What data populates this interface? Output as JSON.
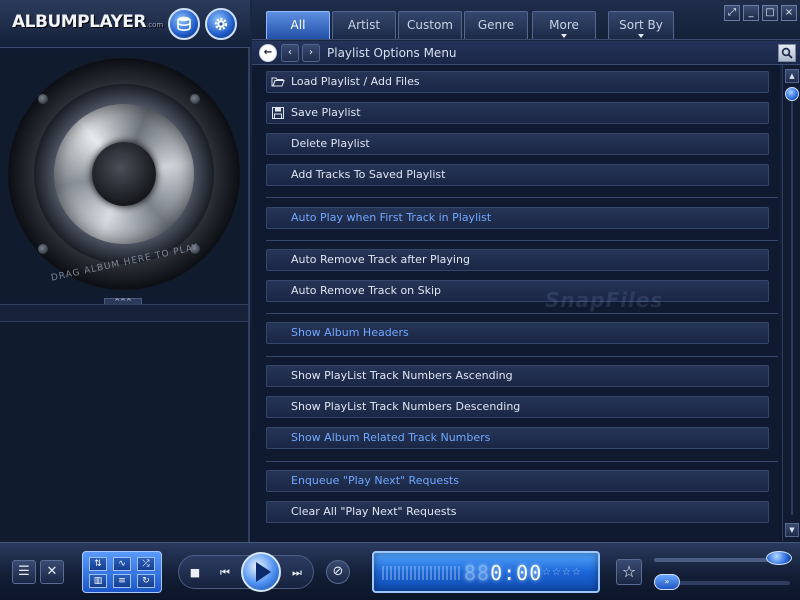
{
  "app": {
    "logo_main": "ALBUMPLAYER",
    "logo_suffix": ".com",
    "drag_hint": "DRAG ALBUM HERE TO PLAY",
    "collapse_label": "^^^"
  },
  "tabs": [
    {
      "label": "All",
      "active": true
    },
    {
      "label": "Artist"
    },
    {
      "label": "Custom"
    },
    {
      "label": "Genre"
    },
    {
      "label": "More",
      "dropdown": true
    },
    {
      "label": "Sort By",
      "dropdown": true
    }
  ],
  "window_buttons": [
    "restore-icon",
    "minimize-icon",
    "maximize-icon",
    "close-icon"
  ],
  "menu_header": {
    "title": "Playlist Options Menu"
  },
  "menu_items": [
    {
      "label": "Load Playlist / Add Files",
      "icon": "folder-open-icon",
      "style": "normal"
    },
    {
      "label": "Save Playlist",
      "icon": "floppy-disk-icon",
      "style": "normal"
    },
    {
      "label": "Delete Playlist",
      "style": "normal"
    },
    {
      "label": "Add Tracks To Saved Playlist",
      "style": "normal"
    },
    {
      "label": "Auto Play when First Track in Playlist",
      "style": "blue"
    },
    {
      "label": "Auto Remove Track after Playing",
      "style": "normal"
    },
    {
      "label": "Auto Remove Track on Skip",
      "style": "normal"
    },
    {
      "label": "Show Album Headers",
      "style": "blue"
    },
    {
      "label": "Show PlayList Track Numbers Ascending",
      "style": "normal"
    },
    {
      "label": "Show PlayList Track Numbers Descending",
      "style": "normal"
    },
    {
      "label": "Show Album Related Track Numbers",
      "style": "blue"
    },
    {
      "label": "Enqueue \"Play Next\" Requests",
      "style": "blue"
    },
    {
      "label": "Clear All \"Play Next\" Requests",
      "style": "normal"
    }
  ],
  "watermark": "SnapFiles",
  "player": {
    "time_dim": "88",
    "time": "0:00",
    "rating_stars": "☆☆☆☆☆"
  },
  "colors": {
    "accent": "#2f6fe0",
    "highlight_text": "#6fa8ff",
    "background": "#0f1a30"
  }
}
